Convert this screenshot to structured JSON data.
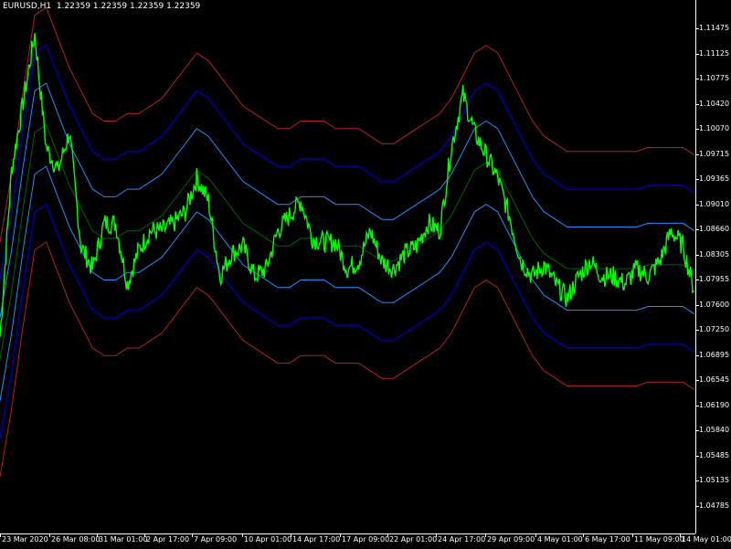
{
  "header": {
    "label": "EURUSD,H1  1.22359 1.22359 1.22359 1.22359"
  },
  "colors": {
    "background": "#000000",
    "price_line": "#00ff00",
    "middle_band": "#006400",
    "inner_band": "#1e90ff",
    "mid_band": "#000080",
    "outer_band": "#b22222",
    "axis": "#ffffff"
  },
  "price_axis": {
    "labels": [
      "1.11475",
      "1.11125",
      "1.10775",
      "1.10420",
      "1.10070",
      "1.09715",
      "1.09365",
      "1.09010",
      "1.08660",
      "1.08305",
      "1.07955",
      "1.07600",
      "1.07250",
      "1.06895",
      "1.06545",
      "1.06190",
      "1.05840",
      "1.05485",
      "1.05135",
      "1.04785"
    ]
  },
  "time_axis": {
    "labels": [
      "23 Mar 2020",
      "26 Mar 08:00",
      "31 Mar 01:00",
      "2 Apr 17:00",
      "7 Apr 09:00",
      "10 Apr 01:00",
      "14 Apr 17:00",
      "17 Apr 09:00",
      "22 Apr 01:00",
      "24 Apr 17:00",
      "29 Apr 09:00",
      "4 May 01:00",
      "6 May 17:00",
      "11 May 09:00",
      "14 May 01:00"
    ]
  },
  "chart_data": {
    "type": "line",
    "title": "",
    "symbol": "EURUSD",
    "timeframe": "H1",
    "ylim": [
      1.046,
      1.1165
    ],
    "x": [
      "23 Mar 2020",
      "26 Mar 08:00",
      "31 Mar 01:00",
      "2 Apr 17:00",
      "7 Apr 09:00",
      "10 Apr 01:00",
      "14 Apr 17:00",
      "17 Apr 09:00",
      "22 Apr 01:00",
      "24 Apr 17:00",
      "29 Apr 09:00",
      "4 May 01:00",
      "6 May 17:00",
      "11 May 09:00",
      "14 May 01:00"
    ],
    "series": [
      {
        "values": [
          1.072,
          1.094,
          1.103,
          1.112,
          1.097,
          1.094,
          1.099,
          1.084,
          1.081,
          1.087,
          1.087,
          1.079,
          1.0835,
          1.086,
          1.086,
          1.087,
          1.0885,
          1.093,
          1.09,
          1.08,
          1.083,
          1.084,
          1.08,
          1.081,
          1.086,
          1.088,
          1.09,
          1.085,
          1.0845,
          1.0845,
          1.081,
          1.082,
          1.086,
          1.082,
          1.081,
          1.083,
          1.084,
          1.087,
          1.086,
          1.097,
          1.104,
          1.099,
          1.096,
          1.093,
          1.088,
          1.082,
          1.08,
          1.0815,
          1.079,
          1.077,
          1.08,
          1.082,
          1.08,
          1.08,
          1.079,
          1.081,
          1.08,
          1.082,
          1.086,
          1.084,
          1.078
        ],
        "color": "#00ff00"
      },
      {
        "values": [
          1.069,
          1.078,
          1.089,
          1.099,
          1.1,
          1.096,
          1.092,
          1.089,
          1.086,
          1.085,
          1.085,
          1.086,
          1.086,
          1.087,
          1.088,
          1.09,
          1.092,
          1.094,
          1.093,
          1.091,
          1.089,
          1.087,
          1.086,
          1.085,
          1.084,
          1.084,
          1.085,
          1.085,
          1.085,
          1.084,
          1.084,
          1.084,
          1.083,
          1.082,
          1.082,
          1.083,
          1.084,
          1.085,
          1.086,
          1.088,
          1.091,
          1.094,
          1.095,
          1.094,
          1.091,
          1.088,
          1.085,
          1.083,
          1.082,
          1.081,
          1.081,
          1.081,
          1.081,
          1.081,
          1.081,
          1.081,
          1.0815,
          1.0815,
          1.0815,
          1.0815,
          1.0805
        ],
        "color": "#006400"
      }
    ]
  }
}
